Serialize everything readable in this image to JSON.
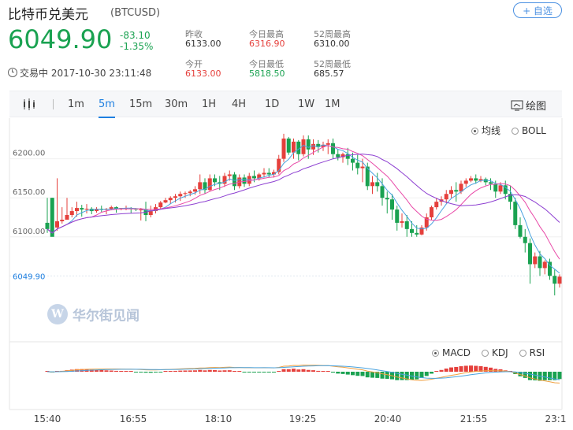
{
  "header": {
    "title": "比特币兑美元",
    "code": "(BTCUSD)",
    "follow_label": "+ 自选"
  },
  "quote": {
    "price": "6049.90",
    "change": "-83.10",
    "change_pct": "-1.35%",
    "status": "交易中 2017-10-30 23:11:48",
    "stats": [
      {
        "label": "昨收",
        "value": "6133.00",
        "color": "#333333"
      },
      {
        "label": "今日最高",
        "value": "6316.90",
        "color": "#e5403c"
      },
      {
        "label": "52周最高",
        "value": "6310.00",
        "color": "#333333"
      },
      {
        "label": "今开",
        "value": "6133.00",
        "color": "#e5403c"
      },
      {
        "label": "今日最低",
        "value": "5818.50",
        "color": "#1aa251"
      },
      {
        "label": "52周最低",
        "value": "685.57",
        "color": "#333333"
      }
    ]
  },
  "toolbar": {
    "chart_type_icon": "candlestick-icon",
    "timeframes": [
      "1m",
      "5m",
      "15m",
      "30m",
      "1H",
      "4H",
      "1D",
      "1W",
      "1M"
    ],
    "active_timeframe": "5m",
    "draw_icon": "draw-tool-icon",
    "draw_label": "绘图"
  },
  "indicators_main": [
    {
      "label": "均线",
      "selected": true
    },
    {
      "label": "BOLL",
      "selected": false
    }
  ],
  "indicators_sub": [
    {
      "label": "MACD",
      "selected": true
    },
    {
      "label": "KDJ",
      "selected": false
    },
    {
      "label": "RSI",
      "selected": false
    }
  ],
  "watermark": "华尔街见闻",
  "colors": {
    "up": "#e5403c",
    "down": "#1aa251",
    "accent": "#1e7fe0"
  },
  "chart_data": {
    "type": "candlestick",
    "y_ticks": [
      "6200.00",
      "6150.00",
      "6100.00"
    ],
    "last_price_label": "6049.90",
    "ylim": [
      6015,
      6240
    ],
    "x_ticks": [
      "15:40",
      "16:55",
      "18:10",
      "19:25",
      "20:40",
      "21:55",
      "23:1"
    ],
    "candles": [
      [
        6118,
        6150,
        6110,
        6105
      ],
      [
        6150,
        6150,
        6100,
        6112
      ],
      [
        6112,
        6175,
        6120,
        6108
      ],
      [
        6120,
        6138,
        6122,
        6117
      ],
      [
        6122,
        6150,
        6128,
        6125
      ],
      [
        6128,
        6138,
        6133,
        6125
      ],
      [
        6133,
        6145,
        6137,
        6126
      ],
      [
        6137,
        6141,
        6135,
        6126
      ],
      [
        6135,
        6142,
        6136,
        6130
      ],
      [
        6136,
        6138,
        6133,
        6129
      ],
      [
        6133,
        6138,
        6136,
        6131
      ],
      [
        6136,
        6140,
        6135,
        6132
      ],
      [
        6135,
        6137,
        6136,
        6129
      ],
      [
        6136,
        6140,
        6138,
        6134
      ],
      [
        6138,
        6139,
        6136,
        6131
      ],
      [
        6136,
        6137,
        6137,
        6134
      ],
      [
        6137,
        6140,
        6137,
        6134
      ],
      [
        6137,
        6138,
        6136,
        6130
      ],
      [
        6136,
        6137,
        6135,
        6133
      ],
      [
        6135,
        6137,
        6135,
        6121
      ],
      [
        6135,
        6145,
        6128,
        6120
      ],
      [
        6128,
        6140,
        6133,
        6125
      ],
      [
        6133,
        6142,
        6138,
        6130
      ],
      [
        6138,
        6146,
        6144,
        6136
      ],
      [
        6144,
        6150,
        6147,
        6143
      ],
      [
        6147,
        6152,
        6150,
        6142
      ],
      [
        6150,
        6155,
        6152,
        6144
      ],
      [
        6152,
        6158,
        6155,
        6146
      ],
      [
        6155,
        6158,
        6156,
        6150
      ],
      [
        6156,
        6160,
        6158,
        6152
      ],
      [
        6158,
        6165,
        6161,
        6154
      ],
      [
        6161,
        6180,
        6170,
        6155
      ],
      [
        6170,
        6175,
        6160,
        6155
      ],
      [
        6160,
        6180,
        6175,
        6158
      ],
      [
        6175,
        6180,
        6170,
        6165
      ],
      [
        6170,
        6178,
        6168,
        6160
      ],
      [
        6168,
        6182,
        6178,
        6164
      ],
      [
        6178,
        6185,
        6180,
        6172
      ],
      [
        6180,
        6183,
        6165,
        6160
      ],
      [
        6165,
        6180,
        6176,
        6162
      ],
      [
        6176,
        6180,
        6168,
        6164
      ],
      [
        6168,
        6182,
        6178,
        6165
      ],
      [
        6178,
        6185,
        6175,
        6170
      ],
      [
        6175,
        6182,
        6180,
        6172
      ],
      [
        6180,
        6188,
        6182,
        6176
      ],
      [
        6182,
        6188,
        6180,
        6176
      ],
      [
        6180,
        6186,
        6183,
        6176
      ],
      [
        6183,
        6205,
        6200,
        6180
      ],
      [
        6200,
        6232,
        6226,
        6196
      ],
      [
        6226,
        6228,
        6208,
        6205
      ],
      [
        6208,
        6226,
        6222,
        6200
      ],
      [
        6222,
        6224,
        6206,
        6198
      ],
      [
        6206,
        6230,
        6225,
        6203
      ],
      [
        6225,
        6230,
        6212,
        6200
      ],
      [
        6212,
        6225,
        6219,
        6205
      ],
      [
        6219,
        6224,
        6215,
        6208
      ],
      [
        6215,
        6222,
        6218,
        6210
      ],
      [
        6218,
        6225,
        6220,
        6206
      ],
      [
        6220,
        6226,
        6206,
        6200
      ],
      [
        6206,
        6212,
        6202,
        6198
      ],
      [
        6202,
        6208,
        6206,
        6195
      ],
      [
        6206,
        6214,
        6200,
        6192
      ],
      [
        6200,
        6208,
        6195,
        6185
      ],
      [
        6195,
        6205,
        6188,
        6180
      ],
      [
        6188,
        6200,
        6190,
        6170
      ],
      [
        6190,
        6195,
        6165,
        6160
      ],
      [
        6165,
        6178,
        6170,
        6155
      ],
      [
        6170,
        6182,
        6165,
        6158
      ],
      [
        6165,
        6175,
        6150,
        6140
      ],
      [
        6150,
        6158,
        6148,
        6130
      ],
      [
        6148,
        6155,
        6135,
        6122
      ],
      [
        6135,
        6140,
        6118,
        6108
      ],
      [
        6118,
        6130,
        6120,
        6112
      ],
      [
        6120,
        6128,
        6110,
        6100
      ],
      [
        6110,
        6120,
        6105,
        6100
      ],
      [
        6105,
        6115,
        6103,
        6100
      ],
      [
        6103,
        6115,
        6112,
        6102
      ],
      [
        6112,
        6130,
        6125,
        6108
      ],
      [
        6125,
        6140,
        6138,
        6122
      ],
      [
        6138,
        6150,
        6145,
        6135
      ],
      [
        6145,
        6152,
        6148,
        6140
      ],
      [
        6148,
        6160,
        6155,
        6143
      ],
      [
        6155,
        6165,
        6160,
        6150
      ],
      [
        6160,
        6170,
        6158,
        6145
      ],
      [
        6158,
        6172,
        6168,
        6155
      ],
      [
        6168,
        6175,
        6172,
        6164
      ],
      [
        6172,
        6178,
        6175,
        6170
      ],
      [
        6175,
        6180,
        6172,
        6168
      ],
      [
        6172,
        6178,
        6174,
        6170
      ],
      [
        6174,
        6176,
        6170,
        6166
      ],
      [
        6170,
        6175,
        6168,
        6160
      ],
      [
        6168,
        6172,
        6158,
        6150
      ],
      [
        6158,
        6170,
        6166,
        6155
      ],
      [
        6166,
        6172,
        6155,
        6148
      ],
      [
        6155,
        6165,
        6145,
        6135
      ],
      [
        6145,
        6150,
        6115,
        6110
      ],
      [
        6115,
        6125,
        6100,
        6098
      ],
      [
        6100,
        6110,
        6092,
        6080
      ],
      [
        6092,
        6098,
        6065,
        6040
      ],
      [
        6065,
        6080,
        6075,
        6060
      ],
      [
        6075,
        6082,
        6060,
        6050
      ],
      [
        6060,
        6070,
        6068,
        6052
      ],
      [
        6068,
        6072,
        6050,
        6045
      ],
      [
        6050,
        6058,
        6040,
        6025
      ],
      [
        6040,
        6052,
        6049,
        6035
      ]
    ]
  }
}
